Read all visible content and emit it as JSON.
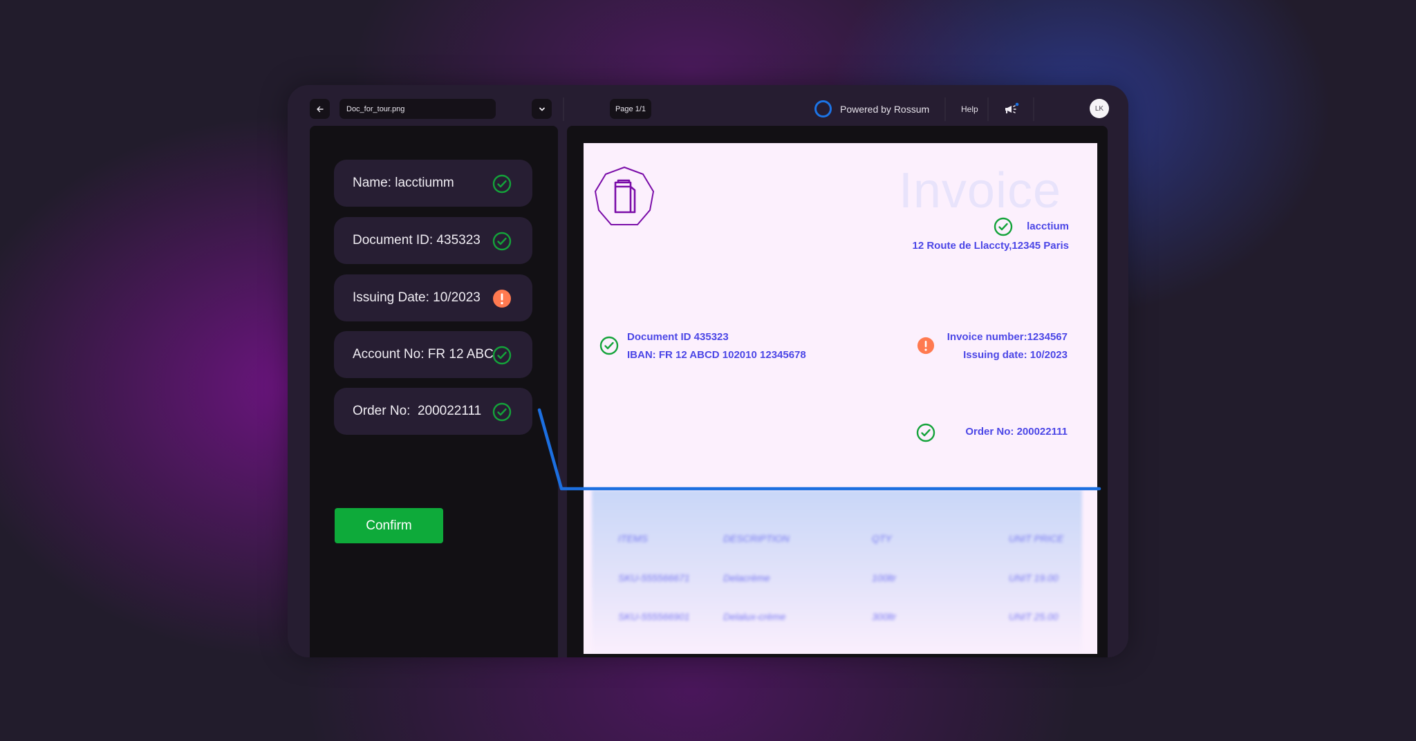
{
  "toolbar": {
    "back_icon": "arrow-left-icon",
    "filename": "Doc_for_tour.png",
    "dropdown_icon": "chevron-down-icon",
    "page_indicator": "Page 1/1",
    "powered_by": "Powered by Rossum",
    "help": "Help",
    "announcements_icon": "megaphone-icon",
    "avatar_initials": "LK"
  },
  "sidebar": {
    "fields": [
      {
        "label": "Name: lacctiumm",
        "status": "ok"
      },
      {
        "label": "Document ID: 435323",
        "status": "ok"
      },
      {
        "label": "Issuing Date: 10/2023",
        "status": "warning"
      },
      {
        "label": "Account No: FR 12 ABC",
        "status": "ok"
      },
      {
        "label": "Order No:  200022111",
        "status": "ok"
      }
    ],
    "confirm_label": "Confirm"
  },
  "document": {
    "title": "Invoice",
    "company_name": "lacctium",
    "company_address": "12 Route de Llaccty,12345 Paris",
    "document_id": "Document ID 435323",
    "iban": "IBAN: FR 12 ABCD 102010 12345678",
    "invoice_number": "Invoice number:1234567",
    "issuing_date": "Issuing date: 10/2023",
    "order_no": "Order No: 200022111",
    "table": {
      "headers": [
        "ITEMS",
        "DESCRIPTION",
        "QTY",
        "UNIT PRICE"
      ],
      "rows": [
        [
          "SKU-555566671",
          "Delacrème",
          "100ltr",
          "UNIT 19.00"
        ],
        [
          "SKU-555566901",
          "Delalux-crème",
          "300ltr",
          "UNIT 25.00"
        ]
      ]
    }
  },
  "colors": {
    "ok": "#14a33a",
    "warning": "#ff7a50",
    "accent_blue": "#1c74e6",
    "confirm_green": "#0eaa3a",
    "doc_text": "#4b46e6",
    "logo_purple": "#7a0ca8"
  }
}
